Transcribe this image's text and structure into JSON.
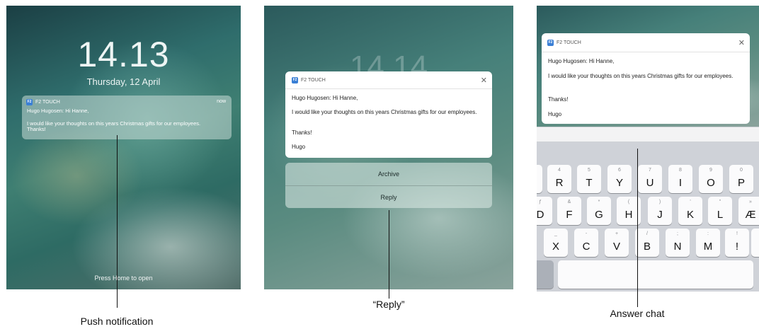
{
  "lock_screen": {
    "time": "14.13",
    "date": "Thursday, 12 April",
    "notification": {
      "app_badge": "F2",
      "app_name": "F2 TOUCH",
      "time": "now",
      "line1": "Hugo Hugosen: Hi Hanne,",
      "line2": "I would like your thoughts on this years Christmas gifts for our employees.",
      "line3": "Thanks!"
    },
    "press_home": "Press Home to open"
  },
  "expanded": {
    "time_blur": "14 14",
    "card": {
      "app_badge": "F2",
      "app_name": "F2 TOUCH",
      "close": "✕",
      "sender": "Hugo Hugosen: Hi Hanne,",
      "body": "I would like your thoughts on this years Christmas gifts for our employees.",
      "thanks": "Thanks!",
      "signature": "Hugo"
    },
    "actions": {
      "archive": "Archive",
      "reply": "Reply"
    }
  },
  "reply_view": {
    "card": {
      "app_badge": "F2",
      "app_name": "F2 TOUCH",
      "close": "✕",
      "sender": "Hugo Hugosen: Hi Hanne,",
      "body": "I would like your thoughts on this years Christmas gifts for our employees.",
      "thanks": "Thanks!",
      "signature": "Hugo"
    },
    "keyboard": {
      "row1": [
        {
          "main": "",
          "sub": ""
        },
        {
          "main": "R",
          "sub": "4"
        },
        {
          "main": "T",
          "sub": "5"
        },
        {
          "main": "Y",
          "sub": "6"
        },
        {
          "main": "U",
          "sub": "7"
        },
        {
          "main": "I",
          "sub": "8"
        },
        {
          "main": "O",
          "sub": "9"
        },
        {
          "main": "P",
          "sub": "0"
        }
      ],
      "row2": [
        {
          "main": "D",
          "sub": "ƒ"
        },
        {
          "main": "F",
          "sub": "&"
        },
        {
          "main": "G",
          "sub": "*"
        },
        {
          "main": "H",
          "sub": "("
        },
        {
          "main": "J",
          "sub": ")"
        },
        {
          "main": "K",
          "sub": "'"
        },
        {
          "main": "L",
          "sub": "\""
        },
        {
          "main": "Æ",
          "sub": "»"
        }
      ],
      "row3": [
        {
          "main": "X",
          "sub": "_"
        },
        {
          "main": "C",
          "sub": "-"
        },
        {
          "main": "V",
          "sub": "+"
        },
        {
          "main": "B",
          "sub": "/"
        },
        {
          "main": "N",
          "sub": ";"
        },
        {
          "main": "M",
          "sub": ":"
        },
        {
          "main": "!",
          "sub": "!"
        },
        {
          "main": "",
          "sub": ""
        }
      ]
    }
  },
  "captions": {
    "push": "Push notification",
    "reply": "“Reply”",
    "answer": "Answer chat"
  }
}
